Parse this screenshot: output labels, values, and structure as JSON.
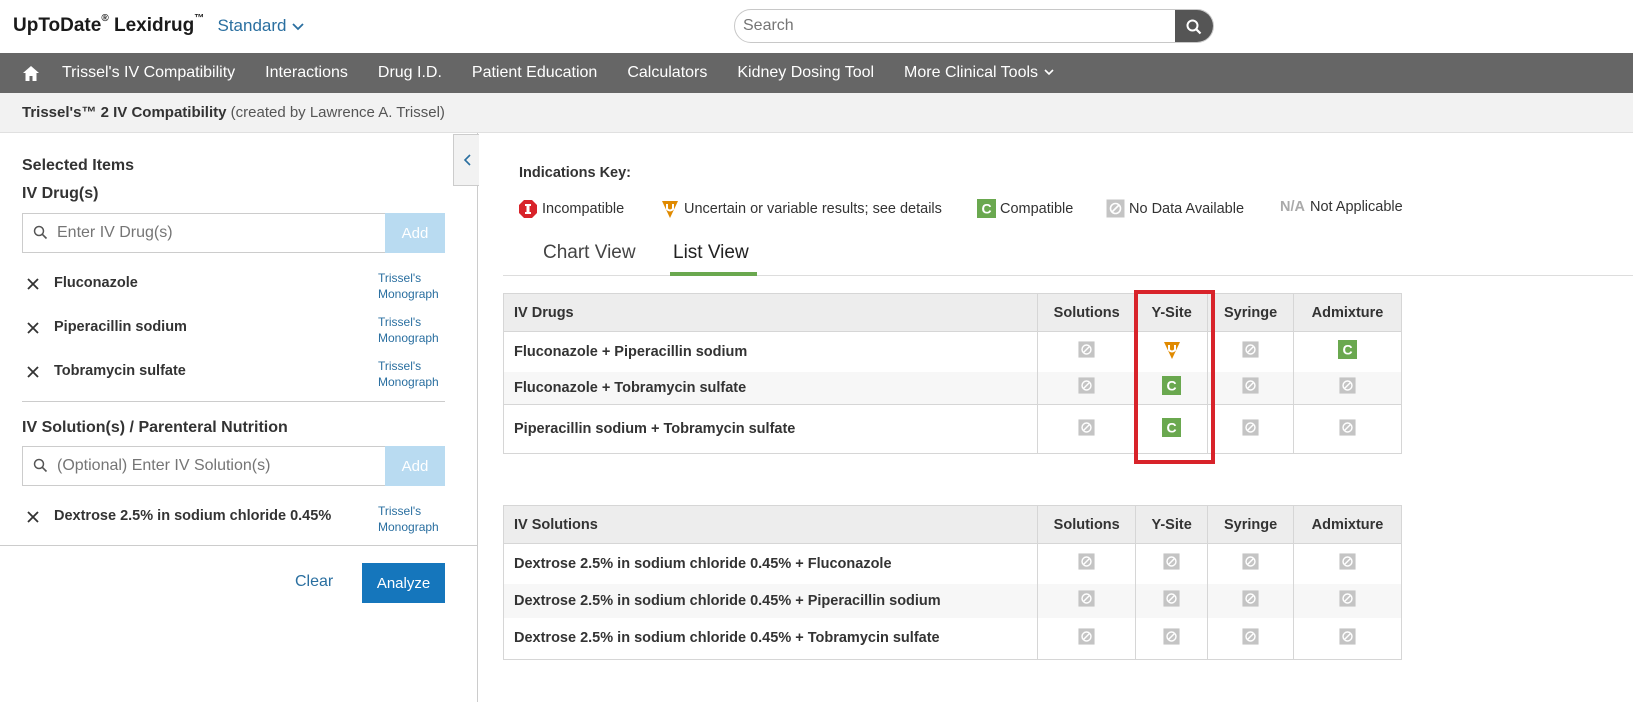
{
  "header": {
    "brand_name": "UpToDate",
    "brand_mark": "®",
    "product": "Lexidrug",
    "product_mark": "™",
    "edition": "Standard",
    "search_placeholder": "Search"
  },
  "nav": {
    "items": [
      {
        "label": "Trissel's IV Compatibility"
      },
      {
        "label": "Interactions"
      },
      {
        "label": "Drug I.D."
      },
      {
        "label": "Patient Education"
      },
      {
        "label": "Calculators"
      },
      {
        "label": "Kidney Dosing Tool"
      },
      {
        "label": "More Clinical Tools"
      }
    ]
  },
  "subheader": {
    "title": "Trissel's™ 2 IV Compatibility",
    "credit": "(created by Lawrence A. Trissel)"
  },
  "left_panel": {
    "selected_title": "Selected Items",
    "drugs_title": "IV Drug(s)",
    "drug_placeholder": "Enter IV Drug(s)",
    "add_label": "Add",
    "monograph_line1": "Trissel's",
    "monograph_line2": "Monograph",
    "drugs": [
      {
        "name": "Fluconazole"
      },
      {
        "name": "Piperacillin sodium"
      },
      {
        "name": "Tobramycin sulfate"
      }
    ],
    "solutions_title": "IV Solution(s) / Parenteral Nutrition",
    "solution_placeholder": "(Optional) Enter IV Solution(s)",
    "solutions": [
      {
        "name": "Dextrose 2.5% in sodium chloride 0.45%"
      }
    ],
    "clear_label": "Clear",
    "analyze_label": "Analyze"
  },
  "key": {
    "title": "Indications Key:",
    "incompatible": "Incompatible",
    "uncertain": "Uncertain or variable results; see details",
    "compatible": "Compatible",
    "no_data": "No Data Available",
    "na_abbrev": "N/A",
    "not_applicable": "Not Applicable"
  },
  "tabs": {
    "chart": "Chart View",
    "list": "List View"
  },
  "columns": {
    "solutions": "Solutions",
    "ysite": "Y-Site",
    "syringe": "Syringe",
    "admixture": "Admixture"
  },
  "drug_table": {
    "header": "IV Drugs",
    "rows": [
      {
        "label": "Fluconazole + Piperacillin sodium",
        "values": [
          "nodata",
          "uncertain",
          "nodata",
          "compatible"
        ]
      },
      {
        "label": "Fluconazole + Tobramycin sulfate",
        "values": [
          "nodata",
          "compatible",
          "nodata",
          "nodata"
        ]
      },
      {
        "label": "Piperacillin sodium + Tobramycin sulfate",
        "values": [
          "nodata",
          "compatible",
          "nodata",
          "nodata"
        ]
      }
    ]
  },
  "solution_table": {
    "header": "IV Solutions",
    "rows": [
      {
        "label": "Dextrose 2.5% in sodium chloride 0.45% + Fluconazole",
        "values": [
          "nodata",
          "nodata",
          "nodata",
          "nodata"
        ]
      },
      {
        "label": "Dextrose 2.5% in sodium chloride 0.45% + Piperacillin sodium",
        "values": [
          "nodata",
          "nodata",
          "nodata",
          "nodata"
        ]
      },
      {
        "label": "Dextrose 2.5% in sodium chloride 0.45% + Tobramycin sulfate",
        "values": [
          "nodata",
          "nodata",
          "nodata",
          "nodata"
        ]
      }
    ]
  },
  "colors": {
    "nav_bg": "#666666",
    "link": "#2a6fa0",
    "primary_button": "#1576bc",
    "compatible": "#6aa84f",
    "uncertain": "#e08a00",
    "incompatible": "#d8232a",
    "highlight_box": "#d8232a"
  }
}
